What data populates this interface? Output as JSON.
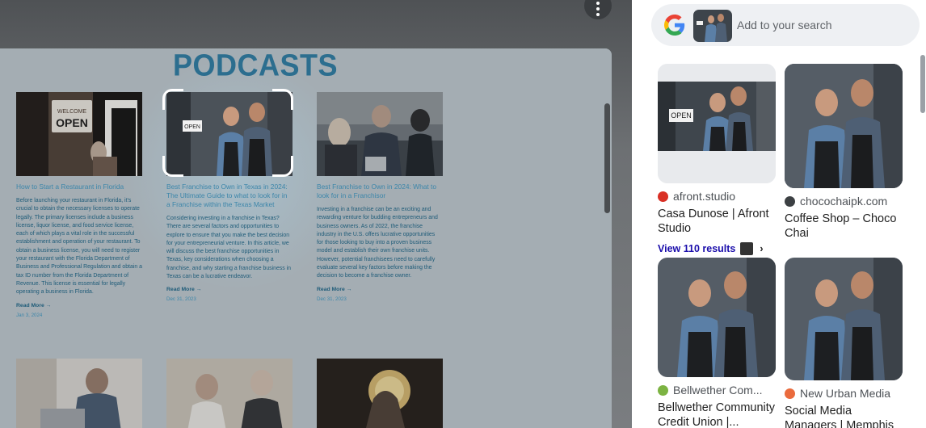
{
  "viewer": {
    "page_title": "PODCASTS",
    "more_icon": "more-vert-icon",
    "cards": [
      {
        "title": "How to Start a Restaurant in Florida",
        "body": "Before launching your restaurant in Florida, it's crucial to obtain the necessary licenses to operate legally. The primary licenses include a business license, liquor license, and food service license, each of which plays a vital role in the successful establishment and operation of your restaurant. To obtain a business license, you will need to register your restaurant with the Florida Department of Business and Professional Regulation and obtain a tax ID number from the Florida Department of Revenue. This license is essential for legally operating a business in Florida.",
        "read_more": "Read More →",
        "date": "Jan 3, 2024",
        "image_subject": "welcome-open-sign"
      },
      {
        "title": "Best Franchise to Own in Texas in 2024: The Ultimate Guide to what to look for in a Franchise within the Texas Market",
        "body": "Considering investing in a franchise in Texas? There are several factors and opportunities to explore to ensure that you make the best decision for your entrepreneurial venture. In this article, we will discuss the best franchise opportunities in Texas, key considerations when choosing a franchise, and why starting a franchise business in Texas can be a lucrative endeavor.",
        "read_more": "Read More →",
        "date": "Dec 31, 2023",
        "image_subject": "couple-open-sign"
      },
      {
        "title": "Best Franchise to Own in 2024: What to look for in a Franchisor",
        "body": "Investing in a franchise can be an exciting and rewarding venture for budding entrepreneurs and business owners. As of 2022, the franchise industry in the U.S. offers lucrative opportunities for those looking to buy into a proven business model and establish their own franchise units. However, potential franchisees need to carefully evaluate several key factors before making the decision to become a franchise owner.",
        "read_more": "Read More →",
        "date": "Dec 31, 2023",
        "image_subject": "business-meeting"
      }
    ]
  },
  "panel": {
    "search_placeholder": "Add to your search",
    "results": [
      {
        "source": "afront.studio",
        "title": "Casa Dunose | Afront Studio",
        "more_label": "View 110 results",
        "fav_color": "#d93025"
      },
      {
        "source": "chocochaipk.com",
        "title": "Coffee Shop – Choco Chai",
        "fav_color": "#3c4043"
      },
      {
        "source": "Bellwether Com...",
        "title": "Bellwether Community Credit Union |...",
        "fav_color": "#7cb342"
      },
      {
        "source": "New Urban Media",
        "title": "Social Media Managers | Memphis",
        "fav_color": "#ea6b3d"
      }
    ]
  }
}
